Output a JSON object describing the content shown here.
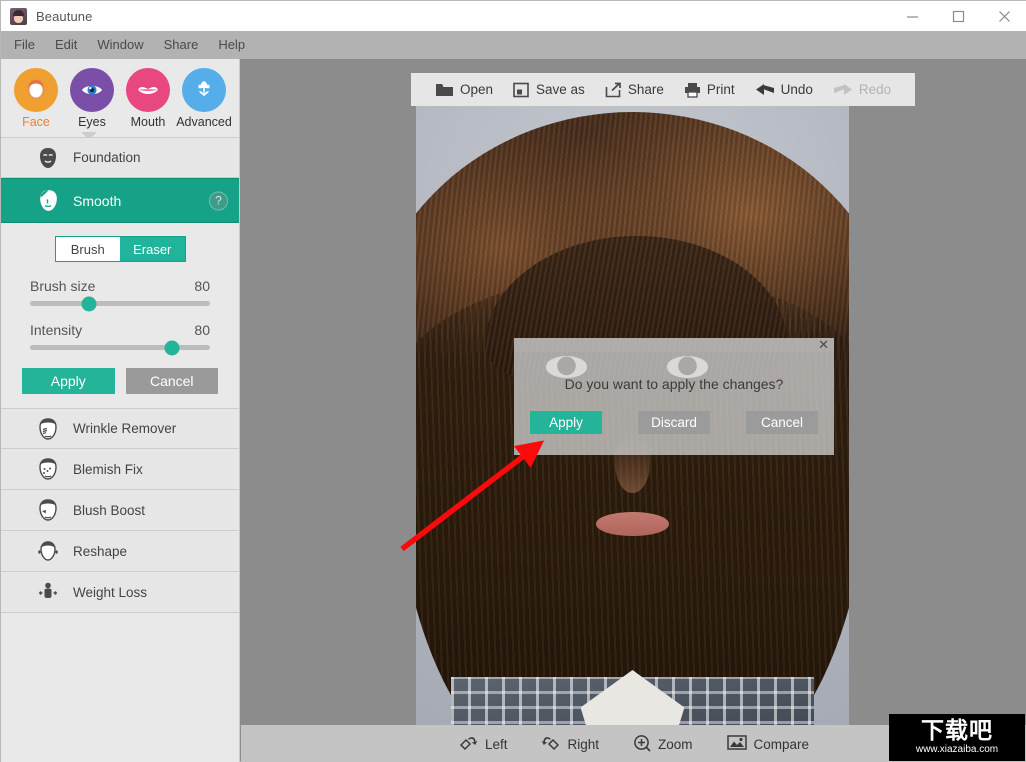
{
  "window": {
    "title": "Beautune",
    "app_icon": "beautune-logo-icon",
    "controls": {
      "minimize": "minimize-icon",
      "maximize": "maximize-icon",
      "close": "close-icon"
    }
  },
  "menubar": {
    "items": [
      "File",
      "Edit",
      "Window",
      "Share",
      "Help"
    ]
  },
  "categories": [
    {
      "label": "Face",
      "icon": "face-icon",
      "color": "#f0a030",
      "active": true
    },
    {
      "label": "Eyes",
      "icon": "eye-icon",
      "color": "#7b4fa8",
      "active": false
    },
    {
      "label": "Mouth",
      "icon": "lips-icon",
      "color": "#e8477f",
      "active": false
    },
    {
      "label": "Advanced",
      "icon": "flower-icon",
      "color": "#55aeea",
      "active": false
    }
  ],
  "tools": [
    {
      "label": "Foundation",
      "icon": "foundation-face-icon",
      "selected": false
    },
    {
      "label": "Smooth",
      "icon": "smooth-face-icon",
      "selected": true,
      "help": "?"
    },
    {
      "label": "Wrinkle Remover",
      "icon": "wrinkle-face-icon",
      "selected": false
    },
    {
      "label": "Blemish Fix",
      "icon": "blemish-face-icon",
      "selected": false
    },
    {
      "label": "Blush Boost",
      "icon": "blush-face-icon",
      "selected": false
    },
    {
      "label": "Reshape",
      "icon": "reshape-face-icon",
      "selected": false
    },
    {
      "label": "Weight Loss",
      "icon": "weight-loss-icon",
      "selected": false
    }
  ],
  "smooth_panel": {
    "mode_brush": "Brush",
    "mode_eraser": "Eraser",
    "selected_mode": "Brush",
    "brush_size_label": "Brush size",
    "brush_size_value": "80",
    "brush_size_percent": 33,
    "intensity_label": "Intensity",
    "intensity_value": "80",
    "intensity_percent": 79,
    "apply_label": "Apply",
    "cancel_label": "Cancel",
    "accent_color": "#23b49a"
  },
  "toolbar": {
    "items": [
      {
        "label": "Open",
        "icon": "folder-open-icon",
        "disabled": false
      },
      {
        "label": "Save as",
        "icon": "save-icon",
        "disabled": false
      },
      {
        "label": "Share",
        "icon": "share-icon",
        "disabled": false
      },
      {
        "label": "Print",
        "icon": "printer-icon",
        "disabled": false
      },
      {
        "label": "Undo",
        "icon": "undo-arrow-icon",
        "disabled": false
      },
      {
        "label": "Redo",
        "icon": "redo-arrow-icon",
        "disabled": true
      }
    ]
  },
  "dialog": {
    "message": "Do you want to apply the changes?",
    "close_icon": "close-icon",
    "buttons": [
      {
        "label": "Apply",
        "style": "primary"
      },
      {
        "label": "Discard",
        "style": "grey"
      },
      {
        "label": "Cancel",
        "style": "grey"
      }
    ]
  },
  "annotation": {
    "arrow_color": "#fa0a0a",
    "points_to": "Apply"
  },
  "bottombar": {
    "items": [
      {
        "label": "Left",
        "icon": "rotate-left-icon"
      },
      {
        "label": "Right",
        "icon": "rotate-right-icon"
      },
      {
        "label": "Zoom",
        "icon": "zoom-in-icon"
      },
      {
        "label": "Compare",
        "icon": "compare-image-icon"
      }
    ]
  },
  "watermark": {
    "text_cn": "下载吧",
    "url": "www.xiazaiba.com"
  }
}
